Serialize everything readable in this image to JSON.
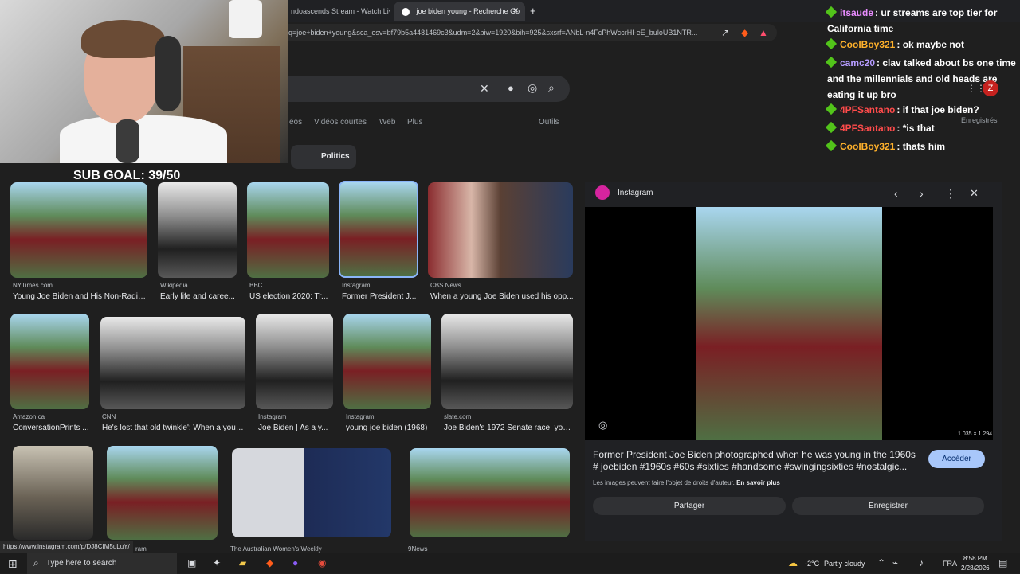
{
  "browser": {
    "tab_stream": "ndoascends Stream - Watch Live c",
    "tab_google": "joe biden young - Recherche Go",
    "url": "q=joe+biden+young&sca_esv=bf79b5a4481469c3&udm=2&biw=1920&bih=925&sxsrf=ANbL-n4FcPhWccrHI-eE_buloUB1NTR...",
    "new_tab": "+"
  },
  "search": {
    "chips": [
      "éos",
      "Vidéos courtes",
      "Web",
      "Plus"
    ],
    "outils": "Outils",
    "saved": "Enregistrés",
    "politics_chip": "Politics"
  },
  "overlay": {
    "sub_goal": "SUB GOAL: 39/50",
    "chat": [
      {
        "name": "itsaude",
        "color": "#e88cff",
        "text": ": ur streams are top tier for California time"
      },
      {
        "name": "CoolBoy321",
        "color": "#ffb12b",
        "text": ": ok maybe not"
      },
      {
        "name": "camc20",
        "color": "#b69cff",
        "text": ": clav talked about bs one time and the millennials and old heads are eating it up bro"
      },
      {
        "name": "4PFSantano",
        "color": "#ff4b4b",
        "text": ": if that joe biden?"
      },
      {
        "name": "4PFSantano",
        "color": "#ff4b4b",
        "text": ": *is that"
      },
      {
        "name": "CoolBoy321",
        "color": "#ffb12b",
        "text": ": thats him"
      }
    ]
  },
  "results": {
    "row1": [
      {
        "source": "NYTimes.com",
        "caption": "Young Joe Biden and His Non-Radic..."
      },
      {
        "source": "Wikipedia",
        "caption": "Early life and caree..."
      },
      {
        "source": "BBC",
        "caption": "US election 2020: Tr..."
      },
      {
        "source": "Instagram",
        "caption": "Former President J..."
      },
      {
        "source": "CBS News",
        "caption": "When a young Joe Biden used his opp..."
      }
    ],
    "row2": [
      {
        "source": "Amazon.ca",
        "caption": "ConversationPrints ..."
      },
      {
        "source": "CNN",
        "caption": "He's lost that old twinkle': When a youn..."
      },
      {
        "source": "Instagram",
        "caption": "Joe Biden | As a y..."
      },
      {
        "source": "Instagram",
        "caption": "young joe biden (1968)"
      },
      {
        "source": "slate.com",
        "caption": "Joe Biden's 1972 Senate race: you..."
      }
    ],
    "row3_sources": [
      "ram",
      "The Australian Women's Weekly",
      "9News"
    ]
  },
  "detail": {
    "site": "Instagram",
    "dimensions": "1 035 × 1 294",
    "description": "Former President Joe Biden photographed when he was young in the 1960s # joebiden #1960s #60s #sixties #handsome #swingingsixties #nostalgic...",
    "rights": "Les images peuvent faire l'objet de droits d'auteur.",
    "learn_more": "En savoir plus",
    "visit": "Accéder",
    "share": "Partager",
    "save": "Enregistrer"
  },
  "status_url": "https://www.instagram.com/p/DJ8CIM5uLuY/",
  "taskbar": {
    "search_placeholder": "Type here to search",
    "weather": "-2°C",
    "weather_text": "Partly cloudy",
    "lang": "FRA",
    "time": "8:58 PM",
    "date": "2/28/2026"
  },
  "avatar_letter": "Z"
}
